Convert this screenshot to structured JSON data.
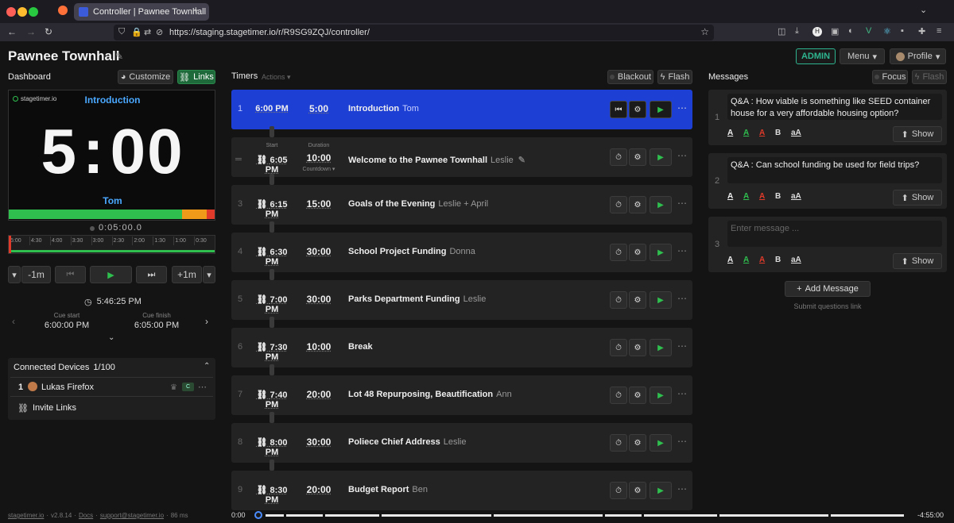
{
  "browser": {
    "tab_title": "Controller | Pawnee Townhall",
    "url": "https://staging.stagetimer.io/r/R9SG9ZQJ/controller/"
  },
  "header": {
    "room_name": "Pawnee Townhall",
    "admin": "ADMIN",
    "menu": "Menu",
    "profile": "Profile"
  },
  "dashboard": {
    "label": "Dashboard",
    "customize": "Customize",
    "links": "Links",
    "logo": "stagetimer.io",
    "title": "Introduction",
    "time_min": "5",
    "time_sec": "00",
    "speaker": "Tom",
    "elapsed": "0:05:00.0",
    "ticks": [
      "5:00",
      "4:30",
      "4:00",
      "3:30",
      "3:00",
      "2:30",
      "2:00",
      "1:30",
      "1:00",
      "0:30"
    ],
    "progress_green": 0.84,
    "progress_orange": 0.12,
    "progress_red": 0.04
  },
  "transport": {
    "minus": "-1m",
    "plus": "+1m"
  },
  "clock": {
    "current_time": "5:46:25 PM",
    "cue_start_label": "Cue start",
    "cue_start": "6:00:00 PM",
    "cue_finish_label": "Cue finish",
    "cue_finish": "6:05:00 PM"
  },
  "devices": {
    "title": "Connected Devices",
    "count": "1/100",
    "items": [
      {
        "num": "1",
        "name": "Lukas Firefox",
        "tag": "C"
      }
    ],
    "invite": "Invite Links"
  },
  "footer": {
    "brand": "stagetimer.io",
    "version": "v2.8.14",
    "docs": "Docs",
    "support": "support@stagetimer.io",
    "latency": "86 ms"
  },
  "timers": {
    "label": "Timers",
    "actions": "Actions",
    "blackout": "Blackout",
    "flash": "Flash",
    "start_label": "Start",
    "duration_label": "Duration",
    "countdown": "Countdown",
    "rows": [
      {
        "num": "1",
        "start": "6:00 PM",
        "duration": "5:00",
        "title": "Introduction",
        "speaker": "Tom"
      },
      {
        "num": "2",
        "start": "6:05 PM",
        "duration": "10:00",
        "title": "Welcome to the Pawnee Townhall",
        "speaker": "Leslie"
      },
      {
        "num": "3",
        "start": "6:15 PM",
        "duration": "15:00",
        "title": "Goals of the Evening",
        "speaker": "Leslie + April"
      },
      {
        "num": "4",
        "start": "6:30 PM",
        "duration": "30:00",
        "title": "School Project Funding",
        "speaker": "Donna"
      },
      {
        "num": "5",
        "start": "7:00 PM",
        "duration": "30:00",
        "title": "Parks Department Funding",
        "speaker": "Leslie"
      },
      {
        "num": "6",
        "start": "7:30 PM",
        "duration": "10:00",
        "title": "Break",
        "speaker": ""
      },
      {
        "num": "7",
        "start": "7:40 PM",
        "duration": "20:00",
        "title": "Lot 48 Repurposing, Beautification",
        "speaker": "Ann"
      },
      {
        "num": "8",
        "start": "8:00 PM",
        "duration": "30:00",
        "title": "Poliece Chief Address",
        "speaker": "Leslie"
      },
      {
        "num": "9",
        "start": "8:30 PM",
        "duration": "20:00",
        "title": "Budget Report",
        "speaker": "Ben"
      }
    ]
  },
  "timeline": {
    "start": "0:00",
    "end": "-4:55:00"
  },
  "messages": {
    "label": "Messages",
    "focus": "Focus",
    "flash": "Flash",
    "show": "Show",
    "add": "Add Message",
    "submit_link": "Submit questions link",
    "items": [
      {
        "num": "1",
        "text": "Q&A : How viable is something like SEED container house for a very affordable housing option?"
      },
      {
        "num": "2",
        "text": "Q&A : Can school funding be used for field trips?"
      },
      {
        "num": "3",
        "text": "",
        "placeholder": "Enter message ..."
      }
    ]
  },
  "colors": {
    "accent_blue": "#1e3fd4",
    "green": "#2fbf4f",
    "orange": "#f09a1a",
    "red": "#e03a2a",
    "admin": "#2eb58f"
  }
}
